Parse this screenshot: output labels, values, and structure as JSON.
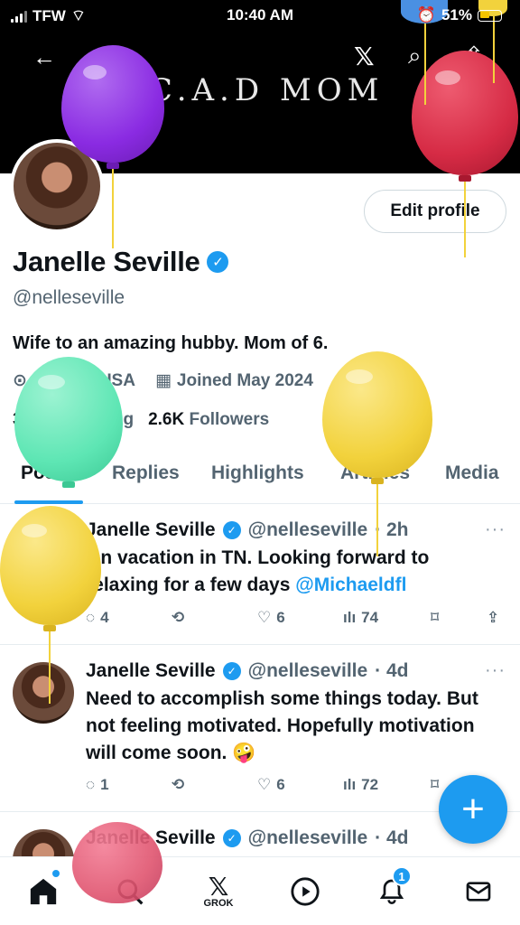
{
  "status_bar": {
    "carrier": "TFW",
    "time": "10:40 AM",
    "battery_pct": "51%"
  },
  "banner": {
    "text": "S.C.A.D MOM"
  },
  "profile": {
    "edit_label": "Edit profile",
    "name": "Janelle Seville",
    "handle": "@nelleseville",
    "bio": "Wife to an amazing hubby. Mom of 6.",
    "location": "Florida, USA",
    "joined": "Joined May 2024",
    "following_count": "3.4K",
    "following_label": "Following",
    "followers_count": "2.6K",
    "followers_label": "Followers"
  },
  "tabs": [
    "Posts",
    "Replies",
    "Highlights",
    "Articles",
    "Media"
  ],
  "posts": [
    {
      "name": "Janelle Seville",
      "handle": "@nelleseville",
      "age": "· 2h",
      "text": "On vacation in TN. Looking forward to relaxing for a few days ",
      "mention": "@Michaeldfl",
      "replies": "4",
      "likes": "6",
      "views": "74"
    },
    {
      "name": "Janelle Seville",
      "handle": "@nelleseville",
      "age": "· 4d",
      "text": "Need to accomplish some things today. But not feeling motivated. Hopefully motivation will come soon. 🤪",
      "replies": "1",
      "likes": "6",
      "views": "72"
    },
    {
      "name": "Janelle Seville",
      "handle": "@nelleseville",
      "age": "· 4d"
    }
  ],
  "bottom_nav": {
    "grok_label": "GROK",
    "notifications_badge": "1"
  },
  "colors": {
    "accent": "#1d9bf0",
    "balloon_purple": "#8a2be2",
    "balloon_red": "#d62b45",
    "balloon_mint": "#5ee6b4",
    "balloon_yellow": "#f2d23c"
  }
}
